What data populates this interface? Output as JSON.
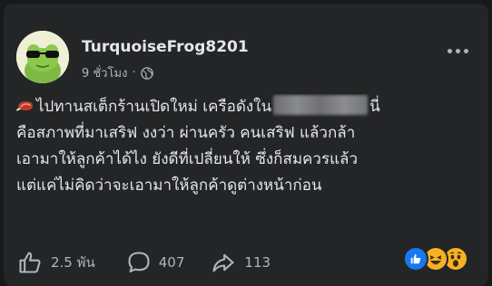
{
  "post": {
    "author": "TurquoiseFrog8201",
    "time": "9 ชั่วโมง",
    "separator": "·",
    "lines": {
      "l1_a": "ไปทานสเต็กร้านเปิดใหม่ เครือดังใน",
      "l1_b": "นี่",
      "l2": "คือสภาพที่มาเสริฟ งงว่า ผ่านครัว คนเสริฟ แล้วกล้า",
      "l3": "เอามาให้ลูกค้าได้ไง ยังดีที่เปลี่ยนให้ ซึ่งก็สมควรแล้ว",
      "l4": "แต่แค่ไม่คิดว่าจะเอามาให้ลูกค้าดูต่างหน้าก่อน"
    }
  },
  "actions": {
    "like_count": "2.5 พัน",
    "comment_count": "407",
    "share_count": "113"
  },
  "icons": {
    "privacy": "globe-icon",
    "more": "more-dots-icon",
    "emoji": "meat-icon"
  },
  "colors": {
    "card_bg": "#242526",
    "page_bg": "#18191a",
    "text": "#e4e6eb",
    "muted": "#b0b3b8",
    "like_blue": "#1877f2",
    "haha_yellow": "#f7b125"
  }
}
